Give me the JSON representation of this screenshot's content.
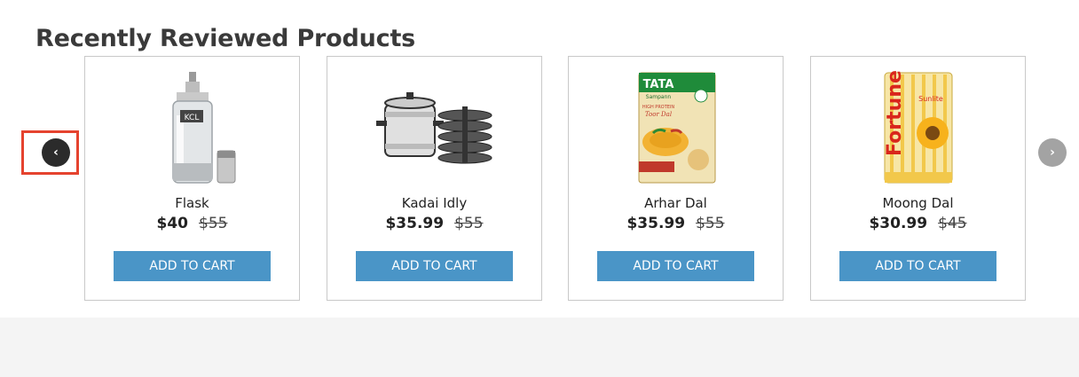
{
  "section": {
    "title": "Recently Reviewed Products"
  },
  "carousel": {
    "prev_icon": "chevron-left-icon",
    "next_icon": "chevron-right-icon",
    "prev_glyph": "‹",
    "next_glyph": "›"
  },
  "products": [
    {
      "name": "Flask",
      "price": "$40",
      "old_price": "$55",
      "button": "ADD TO CART"
    },
    {
      "name": "Kadai Idly",
      "price": "$35.99",
      "old_price": "$55",
      "button": "ADD TO CART"
    },
    {
      "name": "Arhar Dal",
      "price": "$35.99",
      "old_price": "$55",
      "button": "ADD TO CART"
    },
    {
      "name": "Moong Dal",
      "price": "$30.99",
      "old_price": "$45",
      "button": "ADD TO CART"
    }
  ],
  "product_image_text": {
    "flask_label": "KCL",
    "tata_brand": "TATA",
    "tata_sub": "Sampann",
    "tata_tag": "HIGH PROTEIN",
    "tata_product": "Toor Dal",
    "fortune_brand": "Fortune",
    "fortune_sub": "Sunlite"
  },
  "colors": {
    "button": "#4a95c7",
    "highlight_border": "#e5432f",
    "prev_button": "#2b2b2b",
    "next_button": "#a3a3a3"
  }
}
